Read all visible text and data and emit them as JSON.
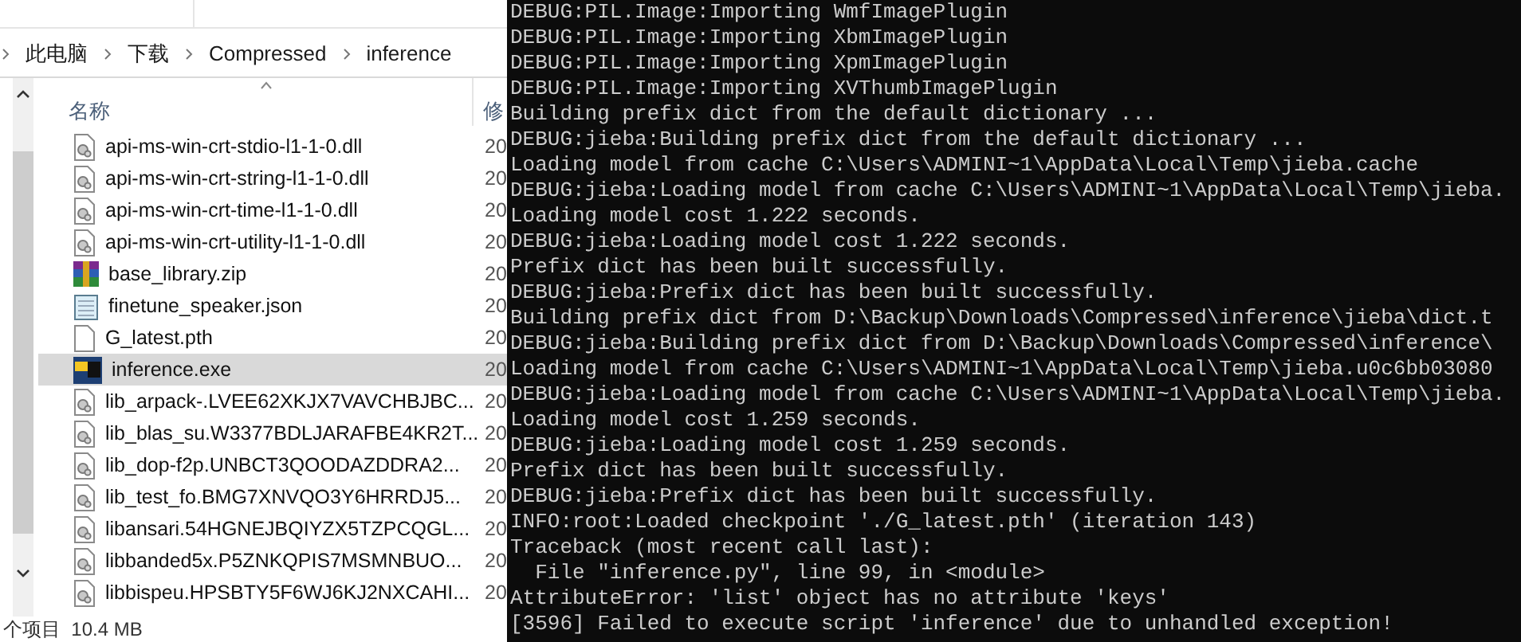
{
  "explorer": {
    "breadcrumb": [
      "此电脑",
      "下载",
      "Compressed",
      "inference"
    ],
    "columns": [
      "名称",
      "修"
    ],
    "files": [
      {
        "name": "api-ms-win-crt-stdio-l1-1-0.dll",
        "kind": "dll",
        "date": "20",
        "selected": false
      },
      {
        "name": "api-ms-win-crt-string-l1-1-0.dll",
        "kind": "dll",
        "date": "20",
        "selected": false
      },
      {
        "name": "api-ms-win-crt-time-l1-1-0.dll",
        "kind": "dll",
        "date": "20",
        "selected": false
      },
      {
        "name": "api-ms-win-crt-utility-l1-1-0.dll",
        "kind": "dll",
        "date": "20",
        "selected": false
      },
      {
        "name": "base_library.zip",
        "kind": "zip",
        "date": "20",
        "selected": false
      },
      {
        "name": "finetune_speaker.json",
        "kind": "json",
        "date": "20",
        "selected": false
      },
      {
        "name": "G_latest.pth",
        "kind": "file",
        "date": "20",
        "selected": false
      },
      {
        "name": "inference.exe",
        "kind": "exe",
        "date": "20",
        "selected": true
      },
      {
        "name": "lib_arpack-.LVEE62XKJX7VAVCHBJBC...",
        "kind": "dll",
        "date": "20",
        "selected": false
      },
      {
        "name": "lib_blas_su.W3377BDLJARAFBE4KR2T...",
        "kind": "dll",
        "date": "20",
        "selected": false
      },
      {
        "name": "lib_dop-f2p.UNBCT3QOODAZDDRA2...",
        "kind": "dll",
        "date": "20",
        "selected": false
      },
      {
        "name": "lib_test_fo.BMG7XNVQO3Y6HRRDJ5...",
        "kind": "dll",
        "date": "20",
        "selected": false
      },
      {
        "name": "libansari.54HGNEJBQIYZX5TZPCQGL...",
        "kind": "dll",
        "date": "20",
        "selected": false
      },
      {
        "name": "libbanded5x.P5ZNKQPIS7MSMNBUO...",
        "kind": "dll",
        "date": "20",
        "selected": false
      },
      {
        "name": "libbispeu.HPSBTY5F6WJ6KJ2NXCAHI...",
        "kind": "dll",
        "date": "20",
        "selected": false
      }
    ],
    "status": "个项目  10.4 MB"
  },
  "console": {
    "lines": [
      "DEBUG:PIL.Image:Importing WmfImagePlugin",
      "DEBUG:PIL.Image:Importing XbmImagePlugin",
      "DEBUG:PIL.Image:Importing XpmImagePlugin",
      "DEBUG:PIL.Image:Importing XVThumbImagePlugin",
      "Building prefix dict from the default dictionary ...",
      "DEBUG:jieba:Building prefix dict from the default dictionary ...",
      "Loading model from cache C:\\Users\\ADMINI~1\\AppData\\Local\\Temp\\jieba.cache",
      "DEBUG:jieba:Loading model from cache C:\\Users\\ADMINI~1\\AppData\\Local\\Temp\\jieba.",
      "Loading model cost 1.222 seconds.",
      "DEBUG:jieba:Loading model cost 1.222 seconds.",
      "Prefix dict has been built successfully.",
      "DEBUG:jieba:Prefix dict has been built successfully.",
      "Building prefix dict from D:\\Backup\\Downloads\\Compressed\\inference\\jieba\\dict.t",
      "DEBUG:jieba:Building prefix dict from D:\\Backup\\Downloads\\Compressed\\inference\\",
      "Loading model from cache C:\\Users\\ADMINI~1\\AppData\\Local\\Temp\\jieba.u0c6bb03080",
      "DEBUG:jieba:Loading model from cache C:\\Users\\ADMINI~1\\AppData\\Local\\Temp\\jieba.",
      "Loading model cost 1.259 seconds.",
      "DEBUG:jieba:Loading model cost 1.259 seconds.",
      "Prefix dict has been built successfully.",
      "DEBUG:jieba:Prefix dict has been built successfully.",
      "INFO:root:Loaded checkpoint './G_latest.pth' (iteration 143)",
      "Traceback (most recent call last):",
      "  File \"inference.py\", line 99, in <module>",
      "AttributeError: 'list' object has no attribute 'keys'",
      "[3596] Failed to execute script 'inference' due to unhandled exception!"
    ]
  }
}
